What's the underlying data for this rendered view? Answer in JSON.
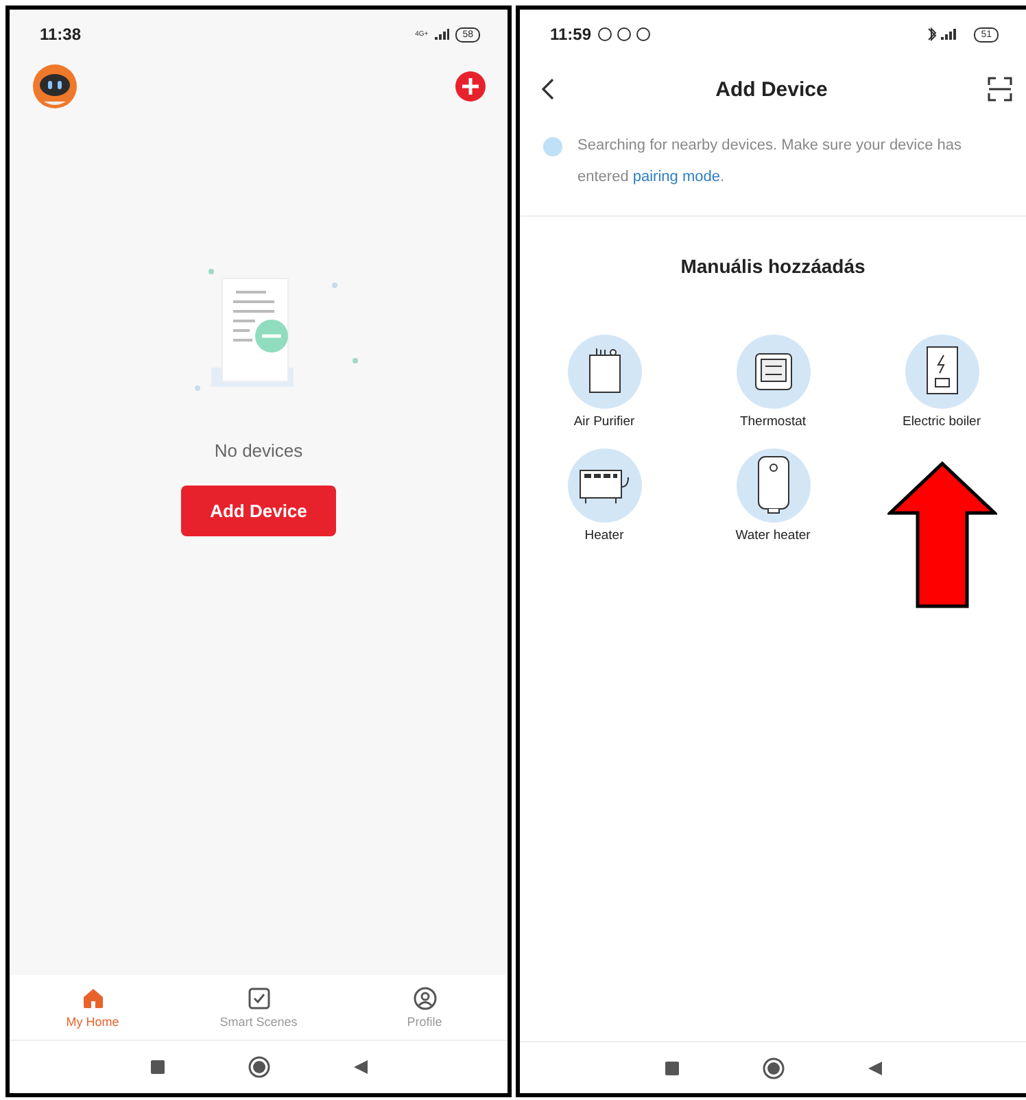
{
  "home": {
    "status_time": "11:38",
    "network": "4G+",
    "battery": "58",
    "empty_text": "No devices",
    "add_button": "Add Device",
    "tabs": [
      {
        "label": "My Home",
        "kind": "home",
        "selected": true
      },
      {
        "label": "Smart Scenes",
        "kind": "scenes",
        "selected": false
      },
      {
        "label": "Profile",
        "kind": "profile",
        "selected": false
      }
    ]
  },
  "add_device": {
    "status_time": "11:59",
    "battery": "51",
    "title": "Add Device",
    "notice": "Searching for nearby devices. Make sure your device has entered ",
    "notice_link": "pairing mode",
    "notice_end": ".",
    "section_title": "Manuális hozzáadás",
    "devices": [
      {
        "label": "Air Purifier",
        "kind": "purifier"
      },
      {
        "label": "Thermostat",
        "kind": "thermostat"
      },
      {
        "label": "Electric boiler",
        "kind": "boiler"
      },
      {
        "label": "Heater",
        "kind": "heater"
      },
      {
        "label": "Water heater",
        "kind": "water_heater"
      }
    ]
  }
}
